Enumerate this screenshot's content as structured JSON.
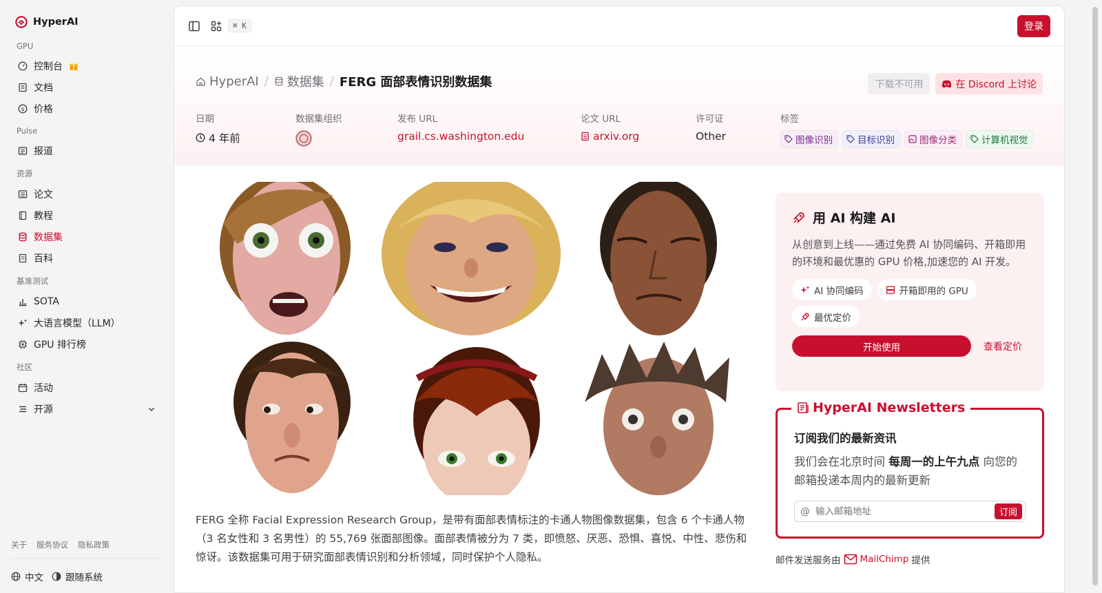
{
  "brand": {
    "name": "HyperAI"
  },
  "sidebar": {
    "groups": [
      {
        "label": "GPU",
        "items": [
          {
            "label": "控制台"
          },
          {
            "label": "文档"
          },
          {
            "label": "价格"
          }
        ]
      },
      {
        "label": "Pulse",
        "items": [
          {
            "label": "报道"
          }
        ]
      },
      {
        "label": "资源",
        "items": [
          {
            "label": "论文"
          },
          {
            "label": "教程"
          },
          {
            "label": "数据集",
            "active": true
          },
          {
            "label": "百科"
          }
        ]
      },
      {
        "label": "基准测试",
        "items": [
          {
            "label": "SOTA"
          },
          {
            "label": "大语言模型（LLM）"
          },
          {
            "label": "GPU 排行榜"
          }
        ]
      },
      {
        "label": "社区",
        "items": [
          {
            "label": "活动"
          },
          {
            "label": "开源"
          }
        ]
      }
    ],
    "footer_links": [
      "关于",
      "服务协议",
      "隐私政策"
    ],
    "language": "中文",
    "theme": "跟随系统"
  },
  "topbar": {
    "shortcut": "⌘ K",
    "login_label": "登录"
  },
  "breadcrumb": {
    "home": "HyperAI",
    "section": "数据集",
    "current": "FERG 面部表情识别数据集"
  },
  "actions": {
    "download": "下载不可用",
    "discord": "在 Discord 上讨论"
  },
  "meta": {
    "date": {
      "label": "日期",
      "value": "4 年前"
    },
    "org": {
      "label": "数据集组织"
    },
    "release_url": {
      "label": "发布 URL",
      "value": "grail.cs.washington.edu"
    },
    "paper_url": {
      "label": "论文 URL",
      "value": "arxiv.org"
    },
    "license": {
      "label": "许可证",
      "value": "Other"
    },
    "tags": {
      "label": "标签",
      "values": [
        "图像识别",
        "目标识别",
        "图像分类",
        "计算机视觉"
      ]
    }
  },
  "description": "FERG 全称 Facial Expression Research Group，是带有面部表情标注的卡通人物图像数据集，包含 6 个卡通人物（3 名女性和 3 名男性）的 55,769 张面部图像。面部表情被分为 7 类，即愤怒、厌恶、恐惧、喜悦、中性、悲伤和惊讶。该数据集可用于研究面部表情识别和分析领域，同时保护个人隐私。",
  "promo": {
    "title": "用 AI 构建 AI",
    "text": "从创意到上线——通过免费 AI 协同编码、开箱即用的环境和最优惠的 GPU 价格,加速您的 AI 开发。",
    "chips": [
      "AI 协同编码",
      "开箱即用的 GPU",
      "最优定价"
    ],
    "start": "开始使用",
    "pricing": "查看定价"
  },
  "newsletter": {
    "title": "HyperAI Newsletters",
    "heading": "订阅我们的最新资讯",
    "text_before": "我们会在北京时间 ",
    "text_bold": "每周一的上午九点",
    "text_after": " 向您的邮箱投递本周内的最新更新",
    "placeholder": "输入邮箱地址",
    "button": "订阅"
  },
  "mail_note": {
    "before": "邮件发送服务由",
    "brand": "MailChimp",
    "after": "提供"
  },
  "colors": {
    "accent": "#c8102e"
  }
}
